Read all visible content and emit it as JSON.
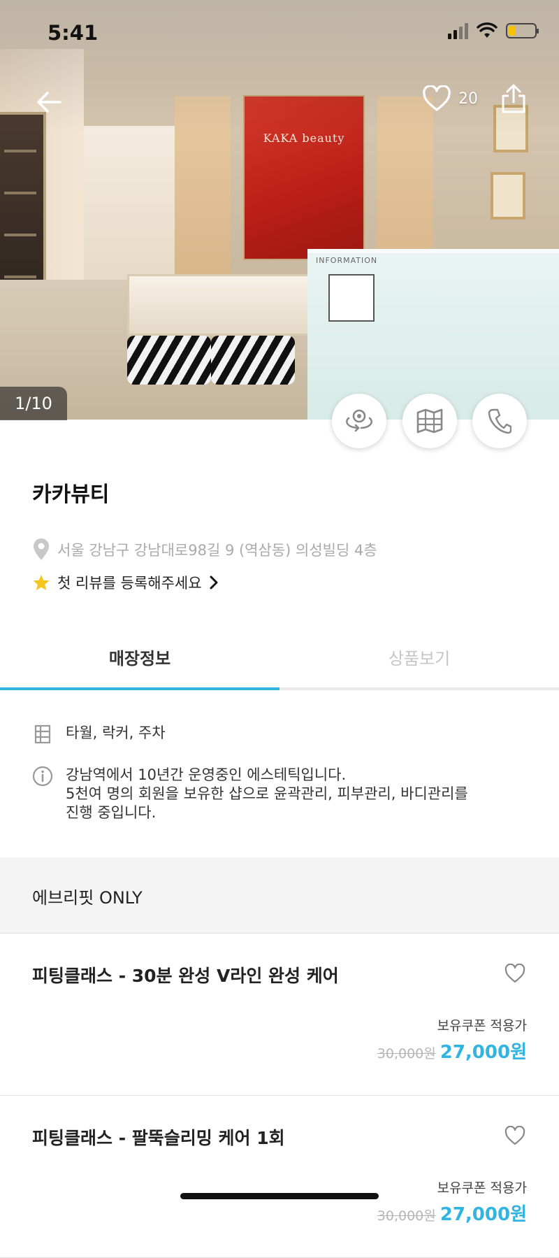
{
  "status_bar": {
    "time": "5:41"
  },
  "hero": {
    "like_count": "20",
    "image_counter": "1/10",
    "sign_text": "KAKA beauty",
    "counter_label": "INFORMATION"
  },
  "store": {
    "name": "카카뷰티",
    "address": "서울 강남구 강남대로98길 9 (역삼동) 의성빌딩 4층",
    "review_prompt": "첫 리뷰를 등록해주세요"
  },
  "tabs": [
    {
      "label": "매장정보",
      "active": true
    },
    {
      "label": "상품보기",
      "active": false
    }
  ],
  "store_info": {
    "amenities": "타월, 락커, 주차",
    "description_lines": [
      "강남역에서 10년간 운영중인 에스테틱입니다.",
      "5천여 명의 회원을 보유한 샵으로 윤곽관리, 피부관리, 바디관리를",
      "진행 중입니다."
    ]
  },
  "section": {
    "title": "에브리핏 ONLY"
  },
  "products": [
    {
      "name": "피팅클래스 - 30분 완성 V라인 완성 케어",
      "coupon_label": "보유쿠폰 적용가",
      "original_price": "30,000원",
      "final_price": "27,000원"
    },
    {
      "name": "피팅클래스 - 팔뚝슬리밍 케어 1회",
      "coupon_label": "보유쿠폰 적용가",
      "original_price": "30,000원",
      "final_price": "27,000원"
    }
  ],
  "colors": {
    "accent": "#31b4e0",
    "star": "#f7c51e",
    "battery": "#f5c400"
  },
  "icons": [
    "back-arrow-icon",
    "heart-icon",
    "share-icon",
    "view-360-icon",
    "map-icon",
    "phone-icon",
    "location-pin-icon",
    "star-icon",
    "chevron-right-icon",
    "amenities-icon",
    "info-icon"
  ]
}
